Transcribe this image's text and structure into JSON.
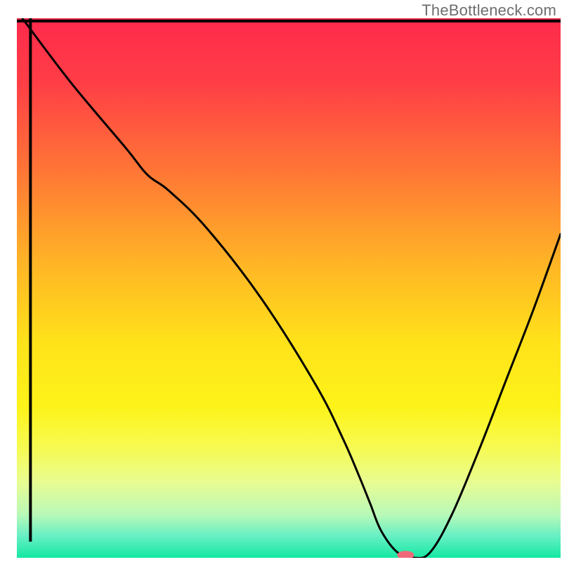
{
  "watermark": "TheBottleneck.com",
  "chart_data": {
    "type": "line",
    "title": "",
    "xlabel": "",
    "ylabel": "",
    "xlim": [
      0,
      100
    ],
    "ylim": [
      0,
      100
    ],
    "grid": false,
    "legend": false,
    "background_gradient": {
      "stops": [
        {
          "offset": 0.0,
          "color": "#ff2a4c"
        },
        {
          "offset": 0.12,
          "color": "#ff3e46"
        },
        {
          "offset": 0.28,
          "color": "#ff7536"
        },
        {
          "offset": 0.45,
          "color": "#ffb326"
        },
        {
          "offset": 0.6,
          "color": "#ffe21a"
        },
        {
          "offset": 0.72,
          "color": "#fdf319"
        },
        {
          "offset": 0.8,
          "color": "#f6fb55"
        },
        {
          "offset": 0.86,
          "color": "#e8fc92"
        },
        {
          "offset": 0.92,
          "color": "#b9f9b8"
        },
        {
          "offset": 0.96,
          "color": "#66efc4"
        },
        {
          "offset": 1.0,
          "color": "#14e8a3"
        }
      ]
    },
    "series": [
      {
        "name": "bottleneck-curve",
        "color": "#000000",
        "x": [
          1,
          10,
          20,
          24,
          28,
          35,
          45,
          55,
          60,
          63,
          65,
          67,
          70,
          73,
          76,
          80,
          85,
          90,
          95,
          100
        ],
        "y": [
          100,
          88,
          76,
          71,
          68,
          61,
          48,
          32,
          22,
          15,
          10,
          5,
          1,
          0,
          1,
          8,
          20,
          33,
          46,
          60
        ]
      }
    ],
    "marker": {
      "name": "optimal-point",
      "x": 71.5,
      "y": 0.5,
      "color": "#ef6a79",
      "rx": 12,
      "ry": 6
    },
    "axes": {
      "left": {
        "x": 2.5,
        "y1": 3,
        "y2": 100
      },
      "bottom": {
        "y": 99.5,
        "x1": 0,
        "x2": 100
      }
    }
  }
}
